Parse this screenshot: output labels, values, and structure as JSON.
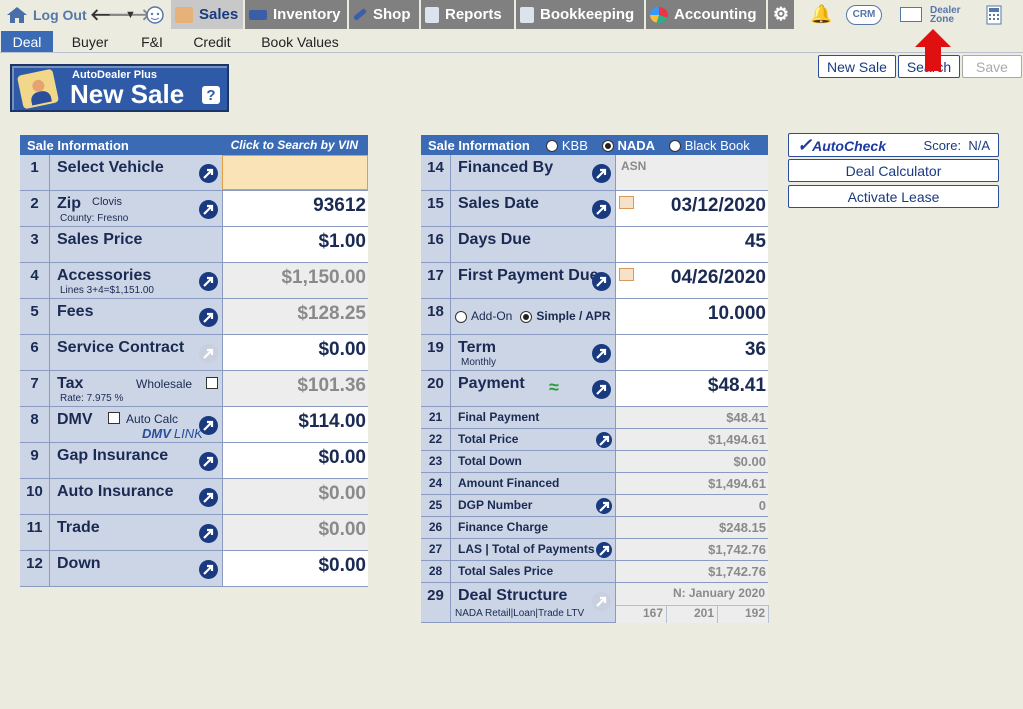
{
  "topbar": {
    "logout": "Log Out",
    "tabs": [
      {
        "label": "Sales",
        "active": true
      },
      {
        "label": "Inventory"
      },
      {
        "label": "Shop"
      },
      {
        "label": "Reports"
      },
      {
        "label": "Bookkeeping"
      },
      {
        "label": "Accounting"
      }
    ],
    "crm": "CRM",
    "dealer_zone": [
      "Dealer",
      "Zone"
    ]
  },
  "subtabs": [
    {
      "label": "Deal",
      "active": true
    },
    {
      "label": "Buyer"
    },
    {
      "label": "F&I"
    },
    {
      "label": "Credit"
    },
    {
      "label": "Book Values"
    }
  ],
  "logo": {
    "small": "AutoDealer Plus",
    "big": "New Sale",
    "help": "?"
  },
  "actions": {
    "new_sale": "New Sale",
    "search": "Search",
    "save": "Save"
  },
  "left": {
    "header": "Sale Information",
    "header_link": "Click to Search by VIN",
    "rows": [
      {
        "num": "1",
        "label": "Select Vehicle",
        "value": ""
      },
      {
        "num": "2",
        "label": "Zip",
        "city": "Clovis",
        "sub": "County: Fresno",
        "value": "93612"
      },
      {
        "num": "3",
        "label": "Sales Price",
        "value": "$1.00"
      },
      {
        "num": "4",
        "label": "Accessories",
        "sub": "Lines 3+4=$1,151.00",
        "value": "$1,150.00"
      },
      {
        "num": "5",
        "label": "Fees",
        "value": "$128.25"
      },
      {
        "num": "6",
        "label": "Service Contract",
        "value": "$0.00"
      },
      {
        "num": "7",
        "label": "Tax",
        "extra": "Wholesale",
        "sub": "Rate: 7.975 %",
        "value": "$101.36"
      },
      {
        "num": "8",
        "label": "DMV",
        "extra": "Auto Calc",
        "logo": "DMV",
        "logo2": "LINK",
        "value": "$114.00"
      },
      {
        "num": "9",
        "label": "Gap Insurance",
        "value": "$0.00"
      },
      {
        "num": "10",
        "label": "Auto Insurance",
        "value": "$0.00"
      },
      {
        "num": "11",
        "label": "Trade",
        "value": "$0.00"
      },
      {
        "num": "12",
        "label": "Down",
        "value": "$0.00"
      }
    ]
  },
  "right": {
    "header": "Sale Information",
    "radios": [
      "KBB",
      "NADA",
      "Black Book"
    ],
    "rows": [
      {
        "num": "14",
        "label": "Financed By",
        "value": "ASN"
      },
      {
        "num": "15",
        "label": "Sales Date",
        "value": "03/12/2020"
      },
      {
        "num": "16",
        "label": "Days Due",
        "value": "45"
      },
      {
        "num": "17",
        "label": "First Payment Due",
        "value": "04/26/2020"
      },
      {
        "num": "18",
        "addon": "Add-On",
        "simple": "Simple / APR",
        "value": "10.000"
      },
      {
        "num": "19",
        "label": "Term",
        "sub": "Monthly",
        "value": "36"
      },
      {
        "num": "20",
        "label": "Payment",
        "value": "$48.41"
      }
    ],
    "small_rows": [
      {
        "num": "21",
        "label": "Final Payment",
        "value": "$48.41"
      },
      {
        "num": "22",
        "label": "Total Price",
        "value": "$1,494.61"
      },
      {
        "num": "23",
        "label": "Total Down",
        "value": "$0.00"
      },
      {
        "num": "24",
        "label": "Amount Financed",
        "value": "$1,494.61"
      },
      {
        "num": "25",
        "label": "DGP Number",
        "value": "0"
      },
      {
        "num": "26",
        "label": "Finance Charge",
        "value": "$248.15"
      },
      {
        "num": "27",
        "label": "LAS | Total of Payments",
        "value": "$1,742.76"
      },
      {
        "num": "28",
        "label": "Total Sales Price",
        "value": "$1,742.76"
      }
    ],
    "deal": {
      "num": "29",
      "label": "Deal Structure",
      "sub": "NADA Retail|Loan|Trade LTV",
      "period": "N: January 2020",
      "ltv": [
        "167",
        "201",
        "192"
      ]
    }
  },
  "side": {
    "autocheck": "AutoCheck",
    "score": "Score:  N/A",
    "calc": "Deal Calculator",
    "lease": "Activate Lease"
  },
  "colors": {
    "header": "#3b6bb5",
    "row": "#ccd5e6",
    "arrow": "#1a3a80",
    "red_arrow": "#e01010"
  }
}
